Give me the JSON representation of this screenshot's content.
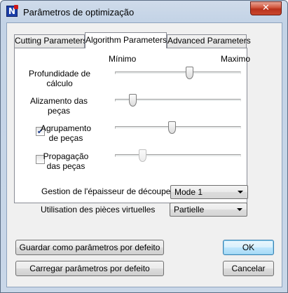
{
  "window": {
    "title": "Parâmetros de optimização",
    "close_glyph": "✕",
    "app_icon_letter": "N"
  },
  "tabs": [
    {
      "label": "Cutting Parameters",
      "active": false
    },
    {
      "label": "Algorithm Parameters",
      "active": true
    },
    {
      "label": "Advanced Parameters",
      "active": false
    }
  ],
  "scale": {
    "min_label": "Mínimo",
    "max_label": "Maximo"
  },
  "sliders": [
    {
      "label_line1": "Profundidade de",
      "label_line2": "cálculo",
      "has_checkbox": false,
      "checked": null,
      "enabled": true,
      "value_fraction": 0.6
    },
    {
      "label_line1": "Alizamento das",
      "label_line2": "peças",
      "has_checkbox": false,
      "checked": null,
      "enabled": true,
      "value_fraction": 0.12
    },
    {
      "label_line1": "Agrupamento",
      "label_line2": "de peças",
      "has_checkbox": true,
      "checked": true,
      "enabled": true,
      "value_fraction": 0.45
    },
    {
      "label_line1": "Propagação",
      "label_line2": "das peças",
      "has_checkbox": true,
      "checked": false,
      "enabled": false,
      "value_fraction": 0.2
    }
  ],
  "check_glyph": "✔",
  "dropdowns": {
    "thickness": {
      "label": "Gestion de l'épaisseur de découpe",
      "value": "Mode 1"
    },
    "virtual_parts": {
      "label": "Utilisation des pièces virtuelles",
      "value": "Partielle"
    }
  },
  "buttons": {
    "save_default": "Guardar como parâmetros por defeito",
    "load_default": "Carregar parâmetros por defeito",
    "ok": "OK",
    "cancel": "Cancelar"
  }
}
